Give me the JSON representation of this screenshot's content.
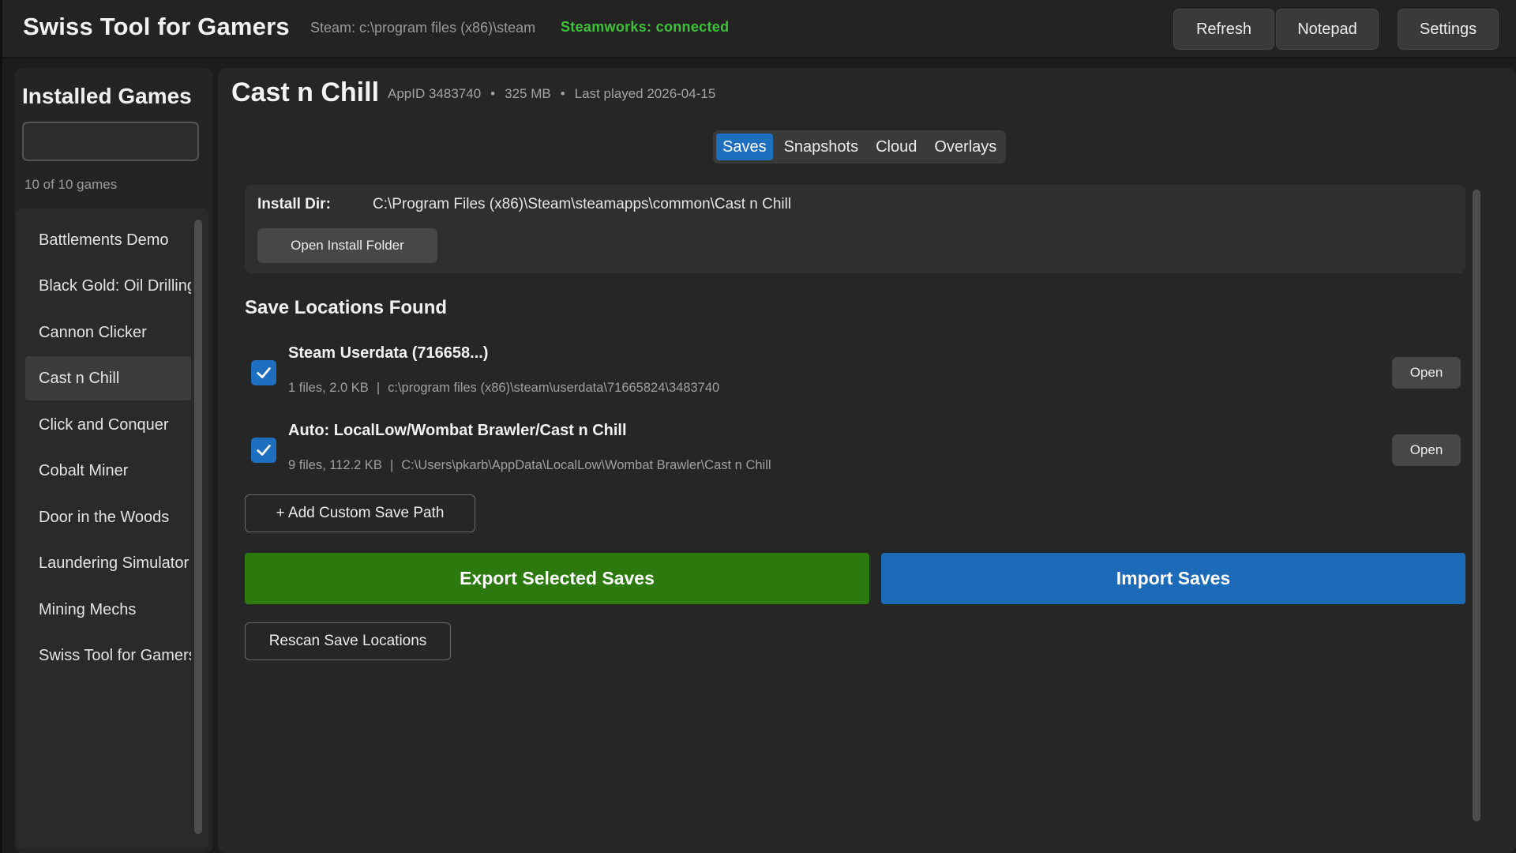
{
  "app": {
    "title": "Swiss Tool for Gamers",
    "steam_path": "Steam: c:\\program files (x86)\\steam",
    "steamworks_status": "Steamworks: connected",
    "status_color": "#3ec23a"
  },
  "toolbar": {
    "refresh_label": "Refresh",
    "notepad_label": "Notepad",
    "settings_label": "Settings"
  },
  "sidebar": {
    "title": "Installed Games",
    "search_value": "",
    "count_text": "10 of 10 games",
    "games": [
      {
        "label": "Battlements Demo"
      },
      {
        "label": "Black Gold: Oil Drilling Simulator"
      },
      {
        "label": "Cannon Clicker"
      },
      {
        "label": "Cast n Chill",
        "selected": true
      },
      {
        "label": "Click and Conquer"
      },
      {
        "label": "Cobalt Miner"
      },
      {
        "label": "Door in the Woods"
      },
      {
        "label": "Laundering Simulator"
      },
      {
        "label": "Mining Mechs"
      },
      {
        "label": "Swiss Tool for Gamers"
      }
    ]
  },
  "game": {
    "title": "Cast n Chill",
    "appid": "AppID 3483740",
    "size": "325 MB",
    "last_played": "Last played 2026-04-15",
    "separator": "•"
  },
  "tabs": [
    {
      "label": "Saves",
      "active": true
    },
    {
      "label": "Snapshots"
    },
    {
      "label": "Cloud"
    },
    {
      "label": "Overlays"
    }
  ],
  "install": {
    "label": "Install Dir:",
    "path": "C:\\Program Files (x86)\\Steam\\steamapps\\common\\Cast n Chill",
    "open_button": "Open Install Folder"
  },
  "saves": {
    "section_title": "Save Locations Found",
    "locations": [
      {
        "title": "Steam Userdata (716658...)",
        "files": "1 files, 2.0 KB",
        "path": "c:\\program files (x86)\\steam\\userdata\\71665824\\3483740",
        "checked": true,
        "open_label": "Open"
      },
      {
        "title": "Auto: LocalLow/Wombat Brawler/Cast n Chill",
        "files": "9 files, 112.2 KB",
        "path": "C:\\Users\\pkarb\\AppData\\LocalLow\\Wombat Brawler\\Cast n Chill",
        "checked": true,
        "open_label": "Open"
      }
    ],
    "detail_separator": "|",
    "add_custom_label": "+ Add Custom Save Path",
    "export_label": "Export Selected Saves",
    "import_label": "Import Saves",
    "rescan_label": "Rescan Save Locations"
  },
  "colors": {
    "accent": "#1f6fc0",
    "export": "#2c7a0e",
    "import": "#1d6bb8"
  }
}
